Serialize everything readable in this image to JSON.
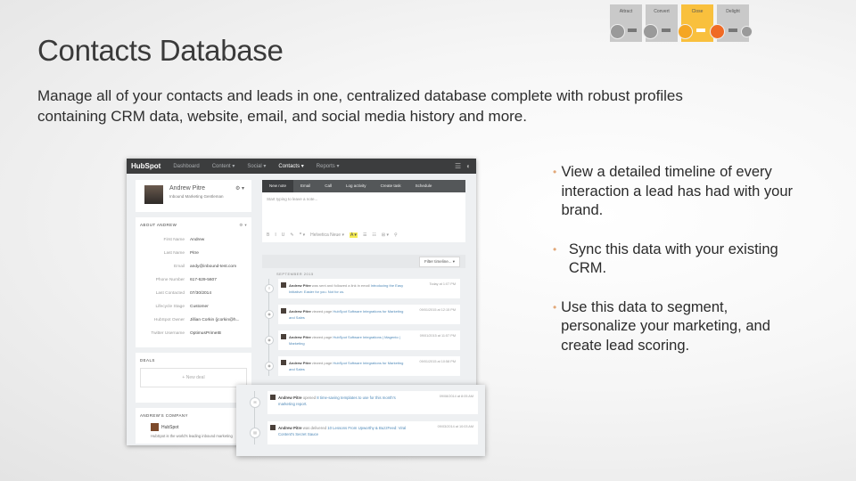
{
  "slide": {
    "title": "Contacts Database",
    "subtitle": "Manage all of your contacts and leads in one, centralized database complete with robust profiles containing CRM data, website, email, and social media history and more."
  },
  "process": {
    "stages": [
      "Attract",
      "Convert",
      "Close",
      "Delight"
    ],
    "highlighted_stage": "Close",
    "colors": {
      "stage": "#c9c9c9",
      "highlight": "#f9c03d",
      "node_gray": "#9a9a9a",
      "node_yellow": "#f5a623",
      "node_orange": "#f06a24"
    }
  },
  "app": {
    "logo": "HubSpot",
    "nav": [
      "Dashboard",
      "Content ▾",
      "Social ▾",
      "Contacts ▾",
      "Reports ▾"
    ],
    "active_nav": "Contacts ▾",
    "contact": {
      "name": "Andrew Pitre",
      "title": "Inbound Marketing Gentleman",
      "about_header": "ABOUT ANDREW",
      "properties": [
        {
          "label": "First Name",
          "value": "Andrew"
        },
        {
          "label": "Last Name",
          "value": "Pitre"
        },
        {
          "label": "Email",
          "value": "andy@inbound-test.com"
        },
        {
          "label": "Phone Number",
          "value": "617-629-5607"
        },
        {
          "label": "Last Contacted",
          "value": "07/30/2014"
        },
        {
          "label": "Lifecycle Stage",
          "value": "Customer"
        },
        {
          "label": "HubSpot Owner",
          "value": "Jillian Corkin (jcorkin@h..."
        },
        {
          "label": "Twitter Username",
          "value": "OptimusPrimeIB"
        }
      ],
      "deals_header": "DEALS",
      "new_deal": "+ New deal",
      "company_header": "ANDREW'S COMPANY",
      "company_name": "HubSpot",
      "company_desc": "HubSpot is the world's leading inbound marketing"
    },
    "actions": [
      "New note",
      "Email",
      "Call",
      "Log activity",
      "Create task",
      "Schedule"
    ],
    "active_action": "New note",
    "editor_placeholder": "Start typing to leave a note...",
    "editor_tools": [
      "B",
      "I",
      "U",
      "✎",
      "❞ ▾",
      "Helvetica Neue ▾",
      "A ▾",
      "☰",
      "☷",
      "⊞ ▾",
      "⚲"
    ],
    "filter_label": "Filter timeline... ▾",
    "timeline_month": "SEPTEMBER 2015",
    "timeline": [
      {
        "icon": "≡",
        "actor": "Andrew Pitre",
        "verb": " was sent and followed a link in email ",
        "link": "Introducing the Easy Initiative: Easier for you. Not for us.",
        "time": "Today at 1:07 PM"
      },
      {
        "icon": "◉",
        "actor": "Andrew Pitre",
        "verb": " viewed page ",
        "link": "HubSpot Software Integrations for Marketing and Sales",
        "time": "09/01/2015 at 12:15 PM"
      },
      {
        "icon": "◉",
        "actor": "Andrew Pitre",
        "verb": " viewed page ",
        "link": "HubSpot Software Integrations | Magento | Marketing",
        "time": "09/01/2015 at 11:57 PM"
      },
      {
        "icon": "◉",
        "actor": "Andrew Pitre",
        "verb": " viewed page ",
        "link": "HubSpot Software Integrations for Marketing and Sales",
        "time": "09/01/2015 at 10:58 PM"
      }
    ],
    "popout": [
      {
        "icon": "✉",
        "actor": "Andrew Pitre",
        "verb": " opened ",
        "link": "8 time-saving templates to use for this month's marketing report.",
        "time": "09/08/2014 at 8:05 AM"
      },
      {
        "icon": "▤",
        "actor": "Andrew Pitre",
        "verb": " was delivered ",
        "link": "10 Lessons From Upworthy & BuzzFeed: Viral Content's Secret Sauce",
        "time": "09/03/2014 at 10:03 AM"
      }
    ]
  },
  "bullets": [
    "View a detailed timeline of every interaction a lead has had with your brand.",
    "Sync this data with your existing CRM.",
    "Use this data to segment, personalize your marketing, and create lead scoring."
  ],
  "colors": {
    "bullet": "#e2a879",
    "link": "#4f89b8",
    "nav_bg": "#3c3d3e"
  }
}
